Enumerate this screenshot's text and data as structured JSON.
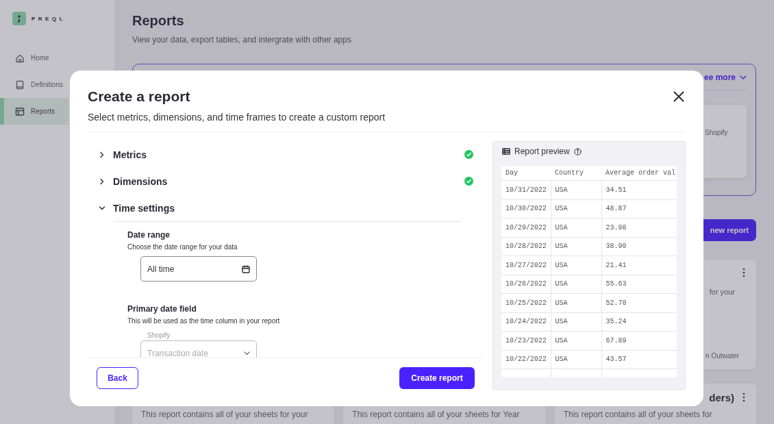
{
  "sidebar": {
    "logo": "PREQL",
    "items": [
      {
        "label": "Home",
        "selected": false
      },
      {
        "label": "Definitions",
        "selected": false
      },
      {
        "label": "Reports",
        "selected": true
      }
    ]
  },
  "page": {
    "title": "Reports",
    "subtitle": "View your data, export tables, and intergrate with other apps",
    "featured": {
      "link": "ee more",
      "card_text": "Shopify"
    },
    "new_report_button": "new report",
    "report_card": {
      "text": "for your",
      "footer": "n Outwater"
    },
    "bottom_cards": [
      {
        "text": "This report contains all of your sheets for your"
      },
      {
        "text": "This report contains all of your sheets for Year"
      },
      {
        "title": "ders)",
        "text": "This report contains all of your sheets for"
      }
    ]
  },
  "modal": {
    "title": "Create a report",
    "subtitle": "Select metrics, dimensions, and time frames to create a custom report",
    "sections": [
      {
        "label": "Metrics",
        "expanded": false,
        "complete": true
      },
      {
        "label": "Dimensions",
        "expanded": false,
        "complete": true
      },
      {
        "label": "Time settings",
        "expanded": true,
        "complete": false,
        "date_range": {
          "label": "Date range",
          "description": "Choose the date range for your data",
          "value": "All time"
        },
        "primary_date": {
          "label": "Primary date field",
          "description": "This will be used as the time column in your report",
          "source": "Shopify",
          "placeholder": "Transaction date"
        }
      }
    ],
    "back_button": "Back",
    "create_button": "Create report",
    "preview": {
      "title": "Report preview",
      "columns": [
        "Day",
        "Country",
        "Average order val"
      ],
      "rows": [
        [
          "10/31/2022",
          "USA",
          "34.51"
        ],
        [
          "10/30/2022",
          "USA",
          "48.87"
        ],
        [
          "10/29/2022",
          "USA",
          "23.98"
        ],
        [
          "10/28/2022",
          "USA",
          "38.90"
        ],
        [
          "10/27/2022",
          "USA",
          "21.41"
        ],
        [
          "10/26/2022",
          "USA",
          "55.63"
        ],
        [
          "10/25/2022",
          "USA",
          "52.78"
        ],
        [
          "10/24/2022",
          "USA",
          "35.24"
        ],
        [
          "10/23/2022",
          "USA",
          "67.89"
        ],
        [
          "10/22/2022",
          "USA",
          "43.57"
        ]
      ]
    }
  }
}
